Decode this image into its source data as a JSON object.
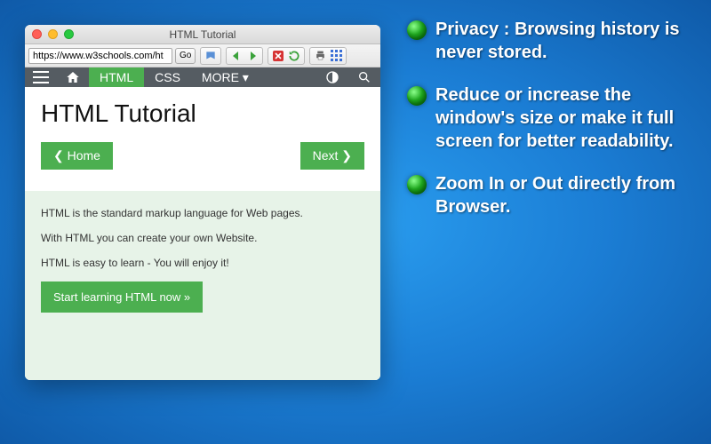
{
  "window": {
    "title": "HTML Tutorial",
    "url": "https://www.w3schools.com/ht",
    "go_label": "Go"
  },
  "site_nav": {
    "items": [
      "HTML",
      "CSS",
      "MORE ▾"
    ],
    "active": "HTML"
  },
  "content": {
    "heading": "HTML Tutorial",
    "home_btn": "❮ Home",
    "next_btn": "Next ❯",
    "paragraphs": [
      "HTML is the standard markup language for Web pages.",
      "With HTML you can create your own Website.",
      "HTML is easy to learn - You will enjoy it!"
    ],
    "cta": "Start learning HTML now »"
  },
  "features": [
    "Privacy : Browsing history is never stored.",
    "Reduce or increase the window's size or make it full screen for better readability.",
    "Zoom In or Out directly from Browser."
  ]
}
